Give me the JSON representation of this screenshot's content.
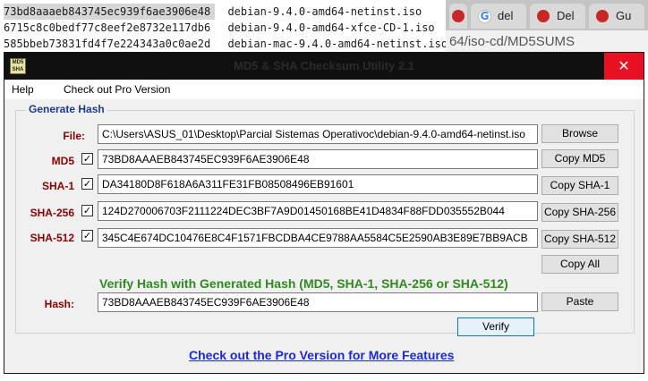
{
  "background": {
    "lines": [
      {
        "hash": "73bd8aaaeb843745ec939f6ae3906e48",
        "file": "debian-9.4.0-amd64-netinst.iso"
      },
      {
        "hash": "6715c8c0bedf77c8eef2e8732e117db6",
        "file": "debian-9.4.0-amd64-xfce-CD-1.iso"
      },
      {
        "hash": "585bbeb73831fd4f7e224343a0c0ae2d",
        "file": "debian-mac-9.4.0-amd64-netinst.iso"
      }
    ],
    "tabs": [
      "del",
      "Del",
      "Gu"
    ],
    "url": "64/iso-cd/MD5SUMS"
  },
  "window": {
    "title": "MD5 & SHA Checksum Utility 2.1",
    "icon_text": "MD5 SHA",
    "close_glyph": "✕"
  },
  "menu": {
    "help": "Help",
    "pro": "Check out Pro Version"
  },
  "generate": {
    "group_label": "Generate Hash",
    "file_label": "File:",
    "file_value": "C:\\Users\\ASUS_01\\Desktop\\Parcial Sistemas Operativoc\\debian-9.4.0-amd64-netinst.iso",
    "browse": "Browse",
    "check_glyph": "✓",
    "rows": [
      {
        "label": "MD5",
        "value": "73BD8AAAEB843745EC939F6AE3906E48",
        "button": "Copy MD5"
      },
      {
        "label": "SHA-1",
        "value": "DA34180D8F618A6A311FE31FB08508496EB91601",
        "button": "Copy SHA-1"
      },
      {
        "label": "SHA-256",
        "value": "124D270006703F2111224DEC3BF7A9D01450168BE41D4834F88FDD035552B044",
        "button": "Copy SHA-256"
      },
      {
        "label": "SHA-512",
        "value": "345C4E674DC10476E8C4F1571FBCDBA4CE9788AA5584C5E2590AB3E89E7BB9ACB",
        "button": "Copy SHA-512"
      }
    ],
    "copy_all": "Copy All"
  },
  "verify": {
    "heading": "Verify Hash with Generated Hash (MD5, SHA-1, SHA-256 or SHA-512)",
    "hash_label": "Hash:",
    "hash_value": "73BD8AAAEB843745EC939F6AE3906E48",
    "paste": "Paste",
    "verify": "Verify"
  },
  "footer": {
    "pro_link": "Check out the Pro Version for More Features"
  }
}
